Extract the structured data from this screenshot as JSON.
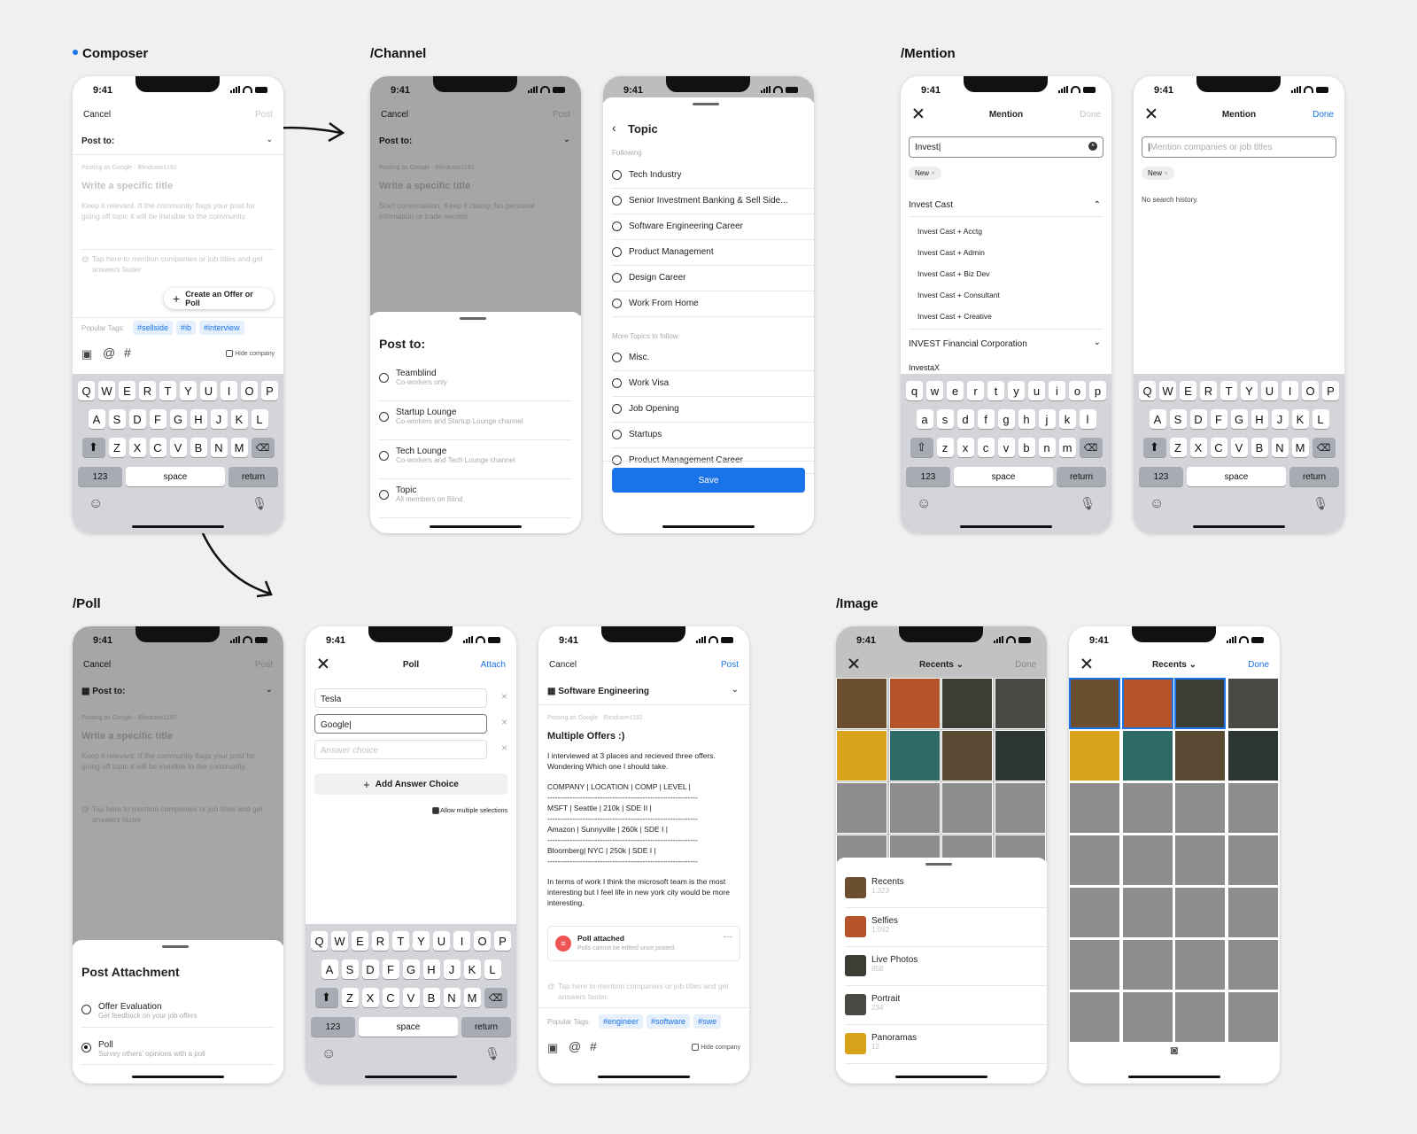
{
  "sections": {
    "composer": "Composer",
    "channel": "/Channel",
    "mention": "/Mention",
    "poll": "/Poll",
    "image": "/Image"
  },
  "status": {
    "time": "9:41"
  },
  "composer": {
    "cancel": "Cancel",
    "post": "Post",
    "post_to": "Post to:",
    "posting_as": "Posting as Google · Blinduser1192",
    "title_ph": "Write a specific title",
    "body_ph": "Keep it relevant. If the community flags your post for going off topic it will be invisible to the community.",
    "mention_ph": "Tap here to mention companies or job titles and get answers faster",
    "create_offer": "Create an Offer or Poll",
    "popular": "Popular Tags:",
    "tags": [
      "#sellside",
      "#ib",
      "#interview"
    ],
    "hide": "Hide company"
  },
  "keyboard": {
    "row1": [
      "Q",
      "W",
      "E",
      "R",
      "T",
      "Y",
      "U",
      "I",
      "O",
      "P"
    ],
    "row2": [
      "A",
      "S",
      "D",
      "F",
      "G",
      "H",
      "J",
      "K",
      "L"
    ],
    "row3": [
      "Z",
      "X",
      "C",
      "V",
      "B",
      "N",
      "M"
    ],
    "row1l": [
      "q",
      "w",
      "e",
      "r",
      "t",
      "y",
      "u",
      "i",
      "o",
      "p"
    ],
    "row2l": [
      "a",
      "s",
      "d",
      "f",
      "g",
      "h",
      "j",
      "k",
      "l"
    ],
    "row3l": [
      "z",
      "x",
      "c",
      "v",
      "b",
      "n",
      "m"
    ],
    "num": "123",
    "space": "space",
    "ret": "return"
  },
  "channel": {
    "bg_body": "Start conversation. Keep it classy. No personal infomation or trade secrets.",
    "sheet_title": "Post to:",
    "options": [
      {
        "name": "Teamblind",
        "sub": "Co-workers only"
      },
      {
        "name": "Startup Lounge",
        "sub": "Co-workers and Startup Lounge channel"
      },
      {
        "name": "Tech Lounge",
        "sub": "Co-workers and Tech Lounge channel"
      },
      {
        "name": "Topic",
        "sub": "All members on Blind"
      }
    ]
  },
  "topic": {
    "title": "Topic",
    "following": "Following",
    "followed": [
      "Tech Industry",
      "Senior Investment Banking & Sell Side...",
      "Software Engineering Career",
      "Product Management",
      "Design Career",
      "Work From Home"
    ],
    "more": "More Topics to follow",
    "more_items": [
      "Misc.",
      "Work Visa",
      "Job Opening",
      "Startups",
      "Product Management Career"
    ],
    "save": "Save"
  },
  "mention1": {
    "title": "Mention",
    "done": "Done",
    "query": "Invest",
    "chip": "New",
    "group": "Invest Cast",
    "items": [
      "Invest Cast + Acctg",
      "Invest Cast + Admin",
      "Invest Cast + Biz Dev",
      "Invest Cast + Consultant",
      "Invest Cast + Creative"
    ],
    "group2": "INVEST Financial Corporation",
    "group3": "InvestaX"
  },
  "mention2": {
    "title": "Mention",
    "done": "Done",
    "placeholder": "Mention companies or job titles",
    "chip": "New",
    "empty": "No search history."
  },
  "pollbg": {
    "sheet_title": "Post Attachment",
    "opts": [
      {
        "name": "Offer Evaluation",
        "sub": "Get feedback on your job offers"
      },
      {
        "name": "Poll",
        "sub": "Survey others' opinions with a poll"
      }
    ]
  },
  "poll": {
    "title": "Poll",
    "attach": "Attach",
    "choices": [
      "Tesla",
      "Google"
    ],
    "placeholder": "Answer choice",
    "add": "Add Answer Choice",
    "multi": "Allow multiple selections"
  },
  "post": {
    "cancel": "Cancel",
    "post": "Post",
    "channel": "Software Engineering",
    "posting_as": "Posting as Google · Blinduser1192",
    "title": "Multiple Offers :)",
    "lines": [
      "I interviewed at 3 places and recieved three offers. Wondering Which one I should take.",
      "COMPANY | LOCATION | COMP | LEVEL |",
      "MSFT | Seattle | 210k | SDE II |",
      "Amazon | Sunnyville | 260k | SDE I |",
      "Bloomberg| NYC | 250k | SDE I |",
      "In terms of work I think the microsoft team is the most interesting but I feel life in new york city would be more interesting."
    ],
    "dashes": "------------------------------------------------------------",
    "poll_title": "Poll attached",
    "poll_sub": "Polls cannot be edited once posted.",
    "mention_ph": "Tap here to mention companies or job titles and get answers faster",
    "popular": "Popular Tags:",
    "tags": [
      "#engineer",
      "#software",
      "#swe"
    ],
    "hide": "Hide company"
  },
  "image1": {
    "title": "Recents",
    "done": "Done",
    "albums": [
      {
        "name": "Recents",
        "count": "1,323"
      },
      {
        "name": "Selfies",
        "count": "1,092"
      },
      {
        "name": "Live Photos",
        "count": "858"
      },
      {
        "name": "Portrait",
        "count": "234"
      },
      {
        "name": "Panoramas",
        "count": "12"
      }
    ]
  },
  "image2": {
    "title": "Recents",
    "done": "Done"
  },
  "colors": {
    "accent": "#1a73e8",
    "keyboard": "#d3d5da",
    "tag_bg": "#e6effc"
  }
}
